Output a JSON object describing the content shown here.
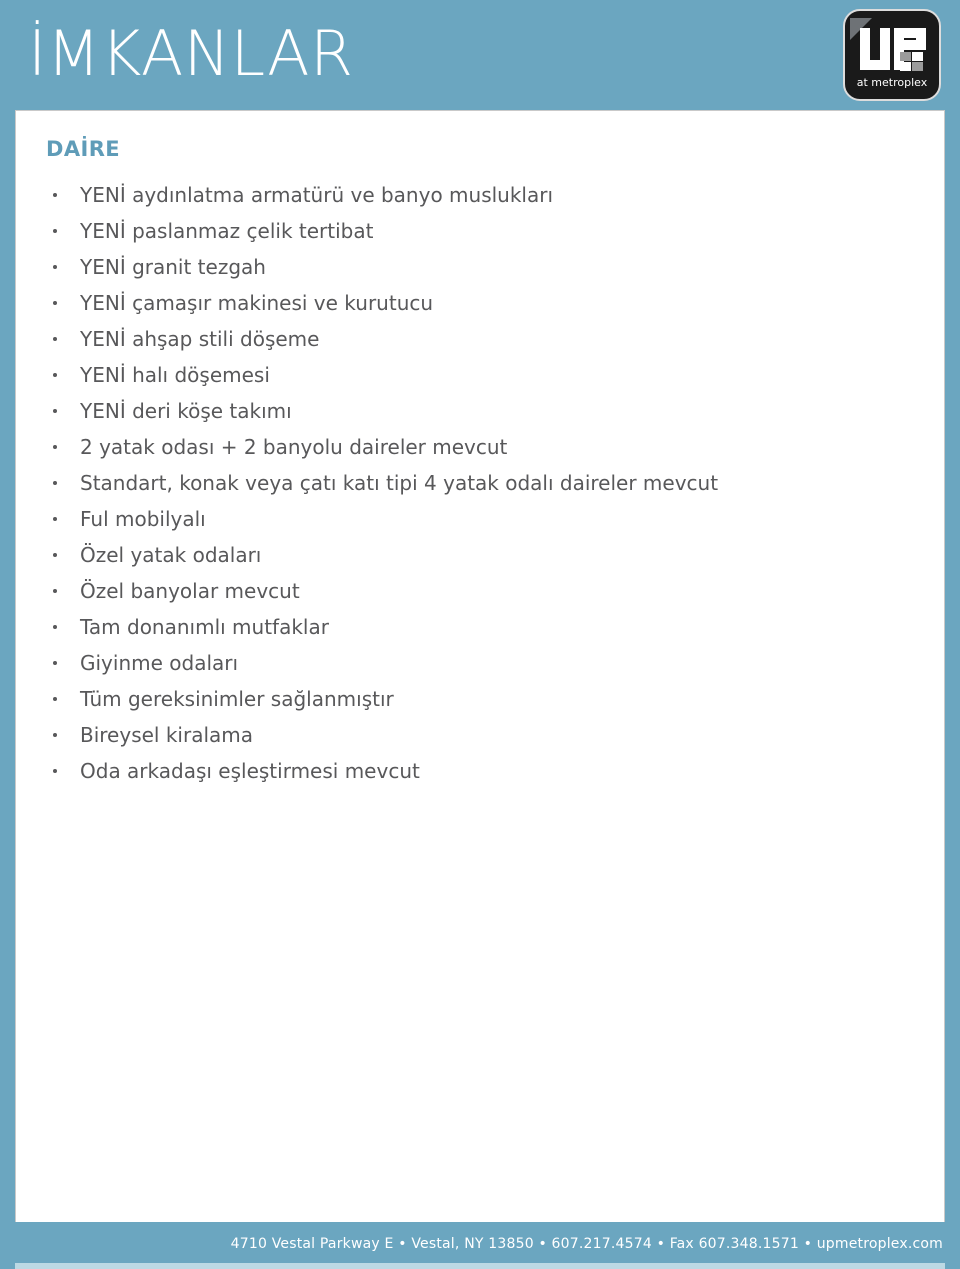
{
  "header": {
    "title": "İMKANLAR",
    "background_color": "#6ba6c0",
    "title_color": "#ffffff",
    "logo": {
      "name": "up-at-metroplex-logo",
      "wordmark": "UP",
      "tagline": "at metroplex",
      "background_color": "#1a1a1a",
      "mark_color": "#ffffff"
    }
  },
  "main": {
    "section_heading": "DAİRE",
    "section_heading_color": "#5f9cb8",
    "features": [
      "YENİ aydınlatma armatürü ve banyo muslukları",
      "YENİ paslanmaz çelik tertibat",
      "YENİ granit tezgah",
      "YENİ çamaşır makinesi ve kurutucu",
      "YENİ ahşap stili döşeme",
      "YENİ halı döşemesi",
      "YENİ deri köşe takımı",
      "2 yatak odası + 2 banyolu daireler mevcut",
      "Standart, konak veya çatı katı tipi 4 yatak odalı daireler mevcut",
      "Ful mobilyalı",
      "Özel yatak odaları",
      "Özel banyolar mevcut",
      "Tam donanımlı mutfaklar",
      "Giyinme odaları",
      "Tüm gereksinimler sağlanmıştır",
      "Bireysel kiralama",
      "Oda arkadaşı eşleştirmesi mevcut"
    ]
  },
  "footer": {
    "text": "4710 Vestal Parkway E • Vestal, NY 13850 • 607.217.4574 • Fax 607.348.1571 • upmetroplex.com",
    "background_color": "#6ba6c0",
    "text_color": "#ffffff"
  }
}
